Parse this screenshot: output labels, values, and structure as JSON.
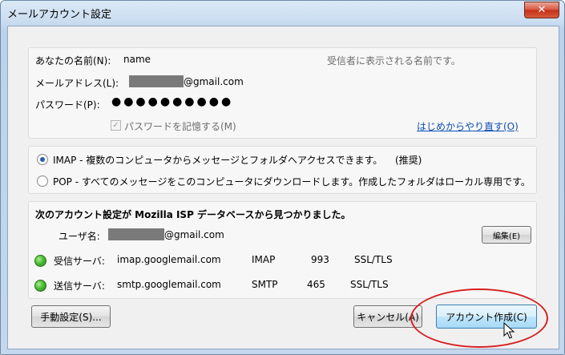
{
  "window": {
    "title": "メールアカウント設定",
    "close_glyph": "✕"
  },
  "identity": {
    "name_label": "あなたの名前(N):",
    "name_value": "name",
    "name_hint": "受信者に表示される名前です。",
    "email_label": "メールアドレス(L):",
    "email_suffix": "@gmail.com",
    "password_label": "パスワード(P):",
    "password_mask": "●●●●●●●●●●",
    "remember_label": "パスワードを記憶する(M)",
    "restart_link": "はじめからやり直す(O)"
  },
  "protocol": {
    "imap_label": "IMAP - 複数のコンピュータからメッセージとフォルダへアクセスできます。",
    "imap_recommend": "(推奨)",
    "pop_label": "POP - すべてのメッセージをこのコンピュータにダウンロードします。作成したフォルダはローカル専用です。",
    "selected": "imap"
  },
  "found": {
    "heading": "次のアカウント設定が Mozilla ISP データベースから見つかりました。",
    "username_label": "ユーザ名:",
    "username_suffix": "@gmail.com",
    "edit_button": "編集(E)",
    "incoming": {
      "label": "受信サーバ:",
      "host": "imap.googlemail.com",
      "type": "IMAP",
      "port": "993",
      "security": "SSL/TLS"
    },
    "outgoing": {
      "label": "送信サーバ:",
      "host": "smtp.googlemail.com",
      "type": "SMTP",
      "port": "465",
      "security": "SSL/TLS"
    }
  },
  "buttons": {
    "manual": "手動設定(S)...",
    "cancel": "キャンセル(A)",
    "create": "アカウント作成(C)"
  },
  "colors": {
    "link": "#0f4fb5",
    "status_ok": "#4cbd34",
    "highlight_ring": "#d62020"
  }
}
